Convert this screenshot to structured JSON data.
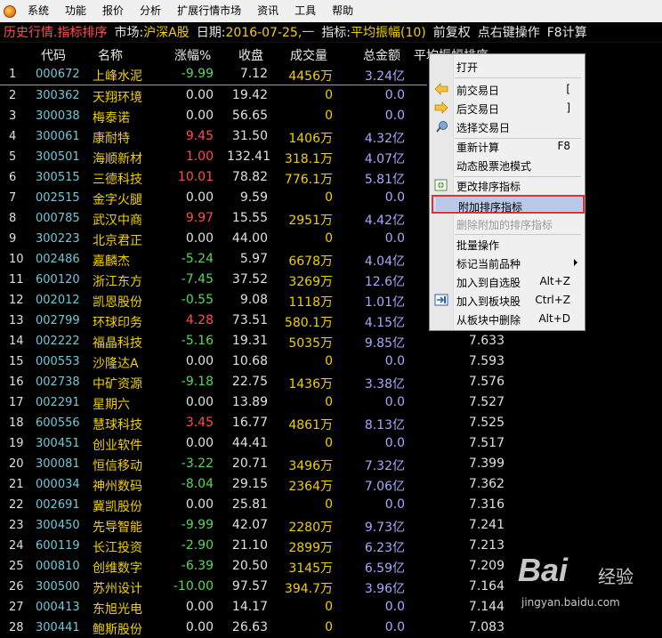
{
  "menu": [
    "系统",
    "功能",
    "报价",
    "分析",
    "扩展行情市场",
    "资讯",
    "工具",
    "帮助"
  ],
  "titlebar": {
    "mode": "历史行情.指标排序",
    "market_label": "市场:",
    "market_value": "沪深A股",
    "date_label": "日期:",
    "date_value": "2016-07-25,一",
    "indicator_label": "指标:",
    "indicator_value": "平均振幅(10)",
    "adjust": "前复权",
    "hint": "点右键操作",
    "f8": "F8计算"
  },
  "columns": {
    "code": "代码",
    "name": "名称",
    "change": "涨幅%",
    "close": "收盘",
    "volume": "成交量",
    "amount": "总金额",
    "indicator": "平均振幅排序"
  },
  "rows": [
    {
      "no": "1",
      "code": "000672",
      "name": "上峰水泥",
      "chg": "-9.99",
      "close": "7.12",
      "vol": "4456万",
      "amt": "3.24亿",
      "ind": ""
    },
    {
      "no": "2",
      "code": "300362",
      "name": "天翔环境",
      "chg": "0.00",
      "close": "19.42",
      "vol": "0",
      "amt": "0.0",
      "ind": ""
    },
    {
      "no": "3",
      "code": "300038",
      "name": "梅泰诺",
      "chg": "0.00",
      "close": "56.65",
      "vol": "0",
      "amt": "0.0",
      "ind": ""
    },
    {
      "no": "4",
      "code": "300061",
      "name": "康耐特",
      "chg": "9.45",
      "close": "31.50",
      "vol": "1406万",
      "amt": "4.32亿",
      "ind": ""
    },
    {
      "no": "5",
      "code": "300501",
      "name": "海顺新材",
      "chg": "1.00",
      "close": "132.41",
      "vol": "318.1万",
      "amt": "4.07亿",
      "ind": ""
    },
    {
      "no": "6",
      "code": "300515",
      "name": "三德科技",
      "chg": "10.01",
      "close": "78.82",
      "vol": "776.1万",
      "amt": "5.81亿",
      "ind": ""
    },
    {
      "no": "7",
      "code": "002515",
      "name": "金字火腿",
      "chg": "0.00",
      "close": "9.59",
      "vol": "0",
      "amt": "0.0",
      "ind": ""
    },
    {
      "no": "8",
      "code": "000785",
      "name": "武汉中商",
      "chg": "9.97",
      "close": "15.55",
      "vol": "2951万",
      "amt": "4.42亿",
      "ind": ""
    },
    {
      "no": "9",
      "code": "300223",
      "name": "北京君正",
      "chg": "0.00",
      "close": "44.00",
      "vol": "0",
      "amt": "0.0",
      "ind": ""
    },
    {
      "no": "10",
      "code": "002486",
      "name": "嘉麟杰",
      "chg": "-5.24",
      "close": "5.97",
      "vol": "6678万",
      "amt": "4.04亿",
      "ind": ""
    },
    {
      "no": "11",
      "code": "600120",
      "name": "浙江东方",
      "chg": "-7.45",
      "close": "37.52",
      "vol": "3269万",
      "amt": "12.6亿",
      "ind": ""
    },
    {
      "no": "12",
      "code": "002012",
      "name": "凯恩股份",
      "chg": "-0.55",
      "close": "9.08",
      "vol": "1118万",
      "amt": "1.01亿",
      "ind": ""
    },
    {
      "no": "13",
      "code": "002799",
      "name": "环球印务",
      "chg": "4.28",
      "close": "73.51",
      "vol": "580.1万",
      "amt": "4.15亿",
      "ind": ""
    },
    {
      "no": "14",
      "code": "002222",
      "name": "福晶科技",
      "chg": "-5.16",
      "close": "19.31",
      "vol": "5035万",
      "amt": "9.85亿",
      "ind": "7.633"
    },
    {
      "no": "15",
      "code": "000553",
      "name": "沙隆达A",
      "chg": "0.00",
      "close": "10.68",
      "vol": "0",
      "amt": "0.0",
      "ind": "7.593"
    },
    {
      "no": "16",
      "code": "002738",
      "name": "中矿资源",
      "chg": "-9.18",
      "close": "22.75",
      "vol": "1436万",
      "amt": "3.38亿",
      "ind": "7.576"
    },
    {
      "no": "17",
      "code": "002291",
      "name": "星期六",
      "chg": "0.00",
      "close": "13.89",
      "vol": "0",
      "amt": "0.0",
      "ind": "7.527"
    },
    {
      "no": "18",
      "code": "600556",
      "name": "慧球科技",
      "chg": "3.45",
      "close": "16.77",
      "vol": "4861万",
      "amt": "8.13亿",
      "ind": "7.525"
    },
    {
      "no": "19",
      "code": "300451",
      "name": "创业软件",
      "chg": "0.00",
      "close": "44.41",
      "vol": "0",
      "amt": "0.0",
      "ind": "7.517"
    },
    {
      "no": "20",
      "code": "300081",
      "name": "恒信移动",
      "chg": "-3.22",
      "close": "20.71",
      "vol": "3496万",
      "amt": "7.32亿",
      "ind": "7.399"
    },
    {
      "no": "21",
      "code": "000034",
      "name": "神州数码",
      "chg": "-8.04",
      "close": "29.15",
      "vol": "2364万",
      "amt": "7.06亿",
      "ind": "7.362"
    },
    {
      "no": "22",
      "code": "002691",
      "name": "冀凯股份",
      "chg": "0.00",
      "close": "25.81",
      "vol": "0",
      "amt": "0.0",
      "ind": "7.316"
    },
    {
      "no": "23",
      "code": "300450",
      "name": "先导智能",
      "chg": "-9.99",
      "close": "42.07",
      "vol": "2280万",
      "amt": "9.73亿",
      "ind": "7.241"
    },
    {
      "no": "24",
      "code": "600119",
      "name": "长江投资",
      "chg": "-2.90",
      "close": "21.10",
      "vol": "2899万",
      "amt": "6.23亿",
      "ind": "7.213"
    },
    {
      "no": "25",
      "code": "000810",
      "name": "创维数字",
      "chg": "-6.39",
      "close": "20.50",
      "vol": "3145万",
      "amt": "6.59亿",
      "ind": "7.209"
    },
    {
      "no": "26",
      "code": "300500",
      "name": "苏州设计",
      "chg": "-10.00",
      "close": "97.57",
      "vol": "394.7万",
      "amt": "3.96亿",
      "ind": "7.164"
    },
    {
      "no": "27",
      "code": "000413",
      "name": "东旭光电",
      "chg": "0.00",
      "close": "14.17",
      "vol": "0",
      "amt": "0.0",
      "ind": "7.144"
    },
    {
      "no": "28",
      "code": "300441",
      "name": "鲍斯股份",
      "chg": "0.00",
      "close": "26.63",
      "vol": "0",
      "amt": "0.0",
      "ind": "7.083"
    }
  ],
  "context_menu": {
    "open": "打开",
    "prev_day": "前交易日",
    "prev_day_key": "[",
    "next_day": "后交易日",
    "next_day_key": "]",
    "pick_day": "选择交易日",
    "recalc": "重新计算",
    "recalc_key": "F8",
    "pool": "动态股票池模式",
    "change_indicator": "更改排序指标",
    "add_indicator": "附加排序指标",
    "remove_indicator": "删除附加的排序指标",
    "batch": "批量操作",
    "mark": "标记当前品种",
    "add_fav": "加入到自选股",
    "add_fav_key": "Alt+Z",
    "add_block": "加入到板块股",
    "add_block_key": "Ctrl+Z",
    "remove_block": "从板块中删除",
    "remove_block_key": "Alt+D"
  },
  "watermark": {
    "brand": "Bai",
    "brand_tail": "经验",
    "url": "jingyan.baidu.com"
  }
}
